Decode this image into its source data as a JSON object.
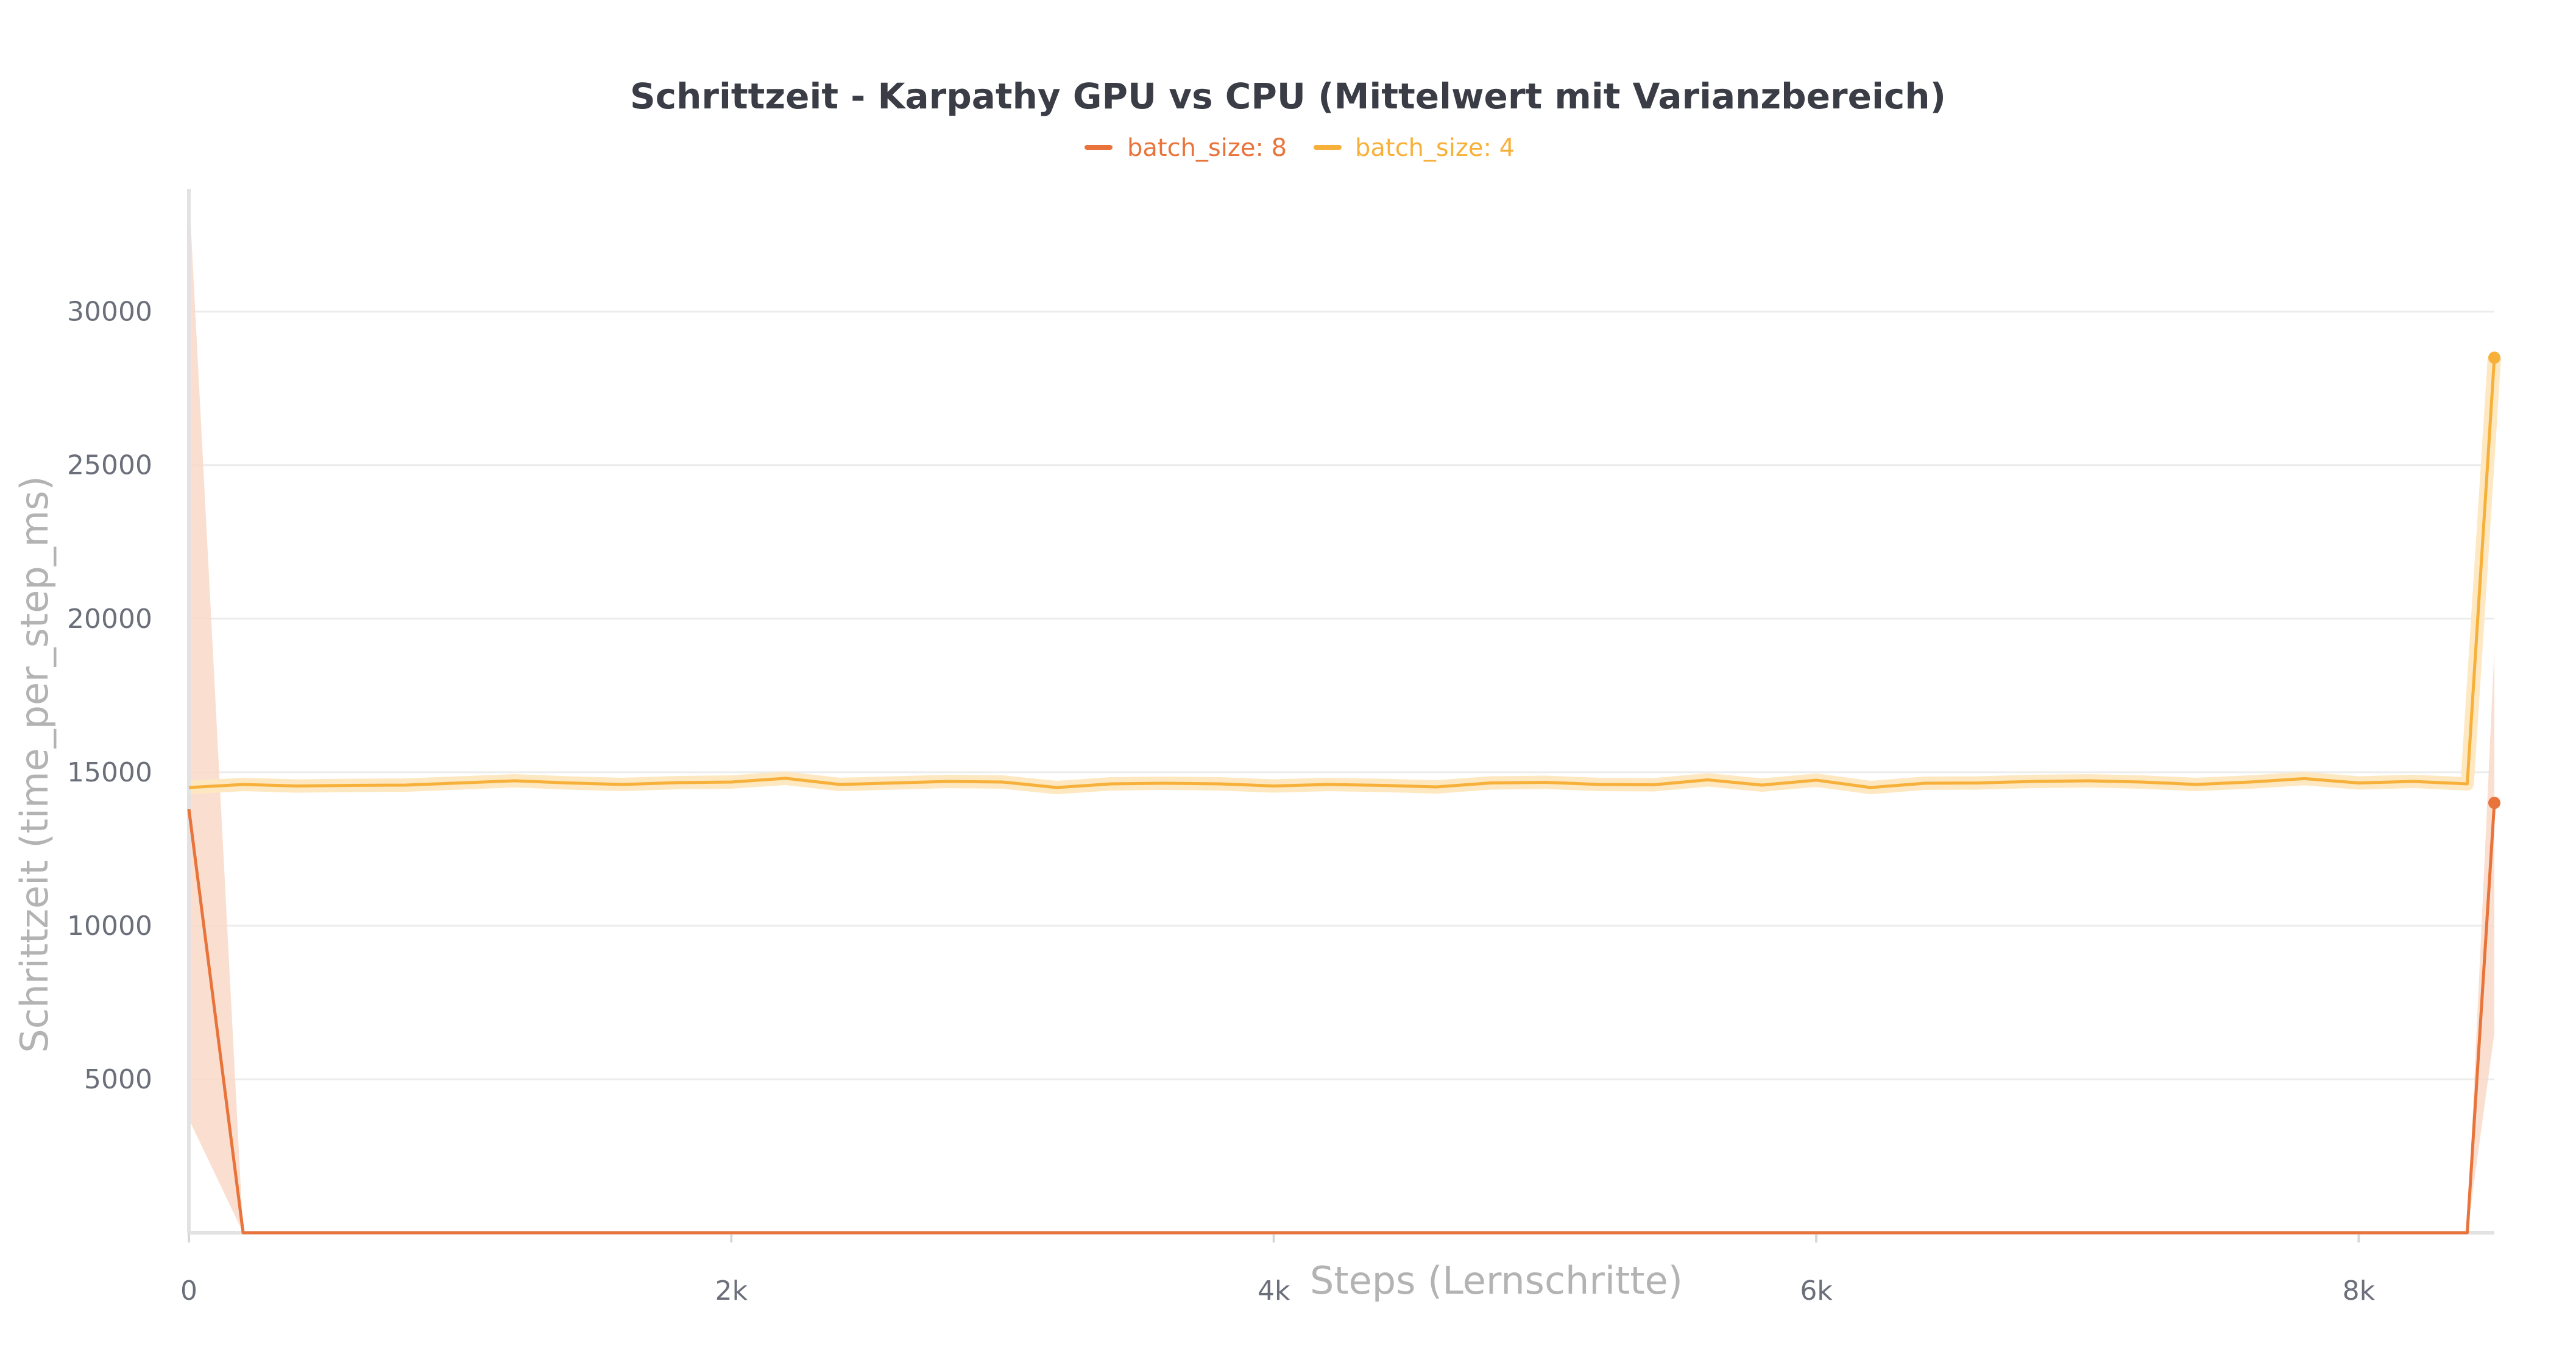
{
  "chart_data": {
    "type": "line",
    "title": "Schrittzeit - Karpathy GPU vs CPU (Mittelwert mit Varianzbereich)",
    "xlabel": "Steps (Lernschritte)",
    "ylabel": "Schrittzeit (time_per_step_ms)",
    "xlim": [
      0,
      8500
    ],
    "ylim": [
      0,
      34000
    ],
    "x_ticks": [
      {
        "value": 0,
        "label": "0"
      },
      {
        "value": 2000,
        "label": "2k"
      },
      {
        "value": 4000,
        "label": "4k"
      },
      {
        "value": 6000,
        "label": "6k"
      },
      {
        "value": 8000,
        "label": "8k"
      }
    ],
    "y_ticks": [
      {
        "value": 5000,
        "label": "5000"
      },
      {
        "value": 10000,
        "label": "10000"
      },
      {
        "value": 15000,
        "label": "15000"
      },
      {
        "value": 20000,
        "label": "20000"
      },
      {
        "value": 25000,
        "label": "25000"
      },
      {
        "value": 30000,
        "label": "30000"
      }
    ],
    "grid": true,
    "legend_position": "top-center",
    "series": [
      {
        "name": "batch_size: 8",
        "color": "#e8743b",
        "band_color": "#f9d9c8",
        "x": [
          0,
          200,
          8400,
          8500
        ],
        "y": [
          13800,
          0,
          0,
          14000
        ],
        "y_lower": [
          3700,
          0,
          0,
          6500
        ],
        "y_upper": [
          34000,
          0,
          0,
          19000
        ],
        "end_marker": true
      },
      {
        "name": "batch_size: 4",
        "color": "#f7b13b",
        "band_color": "#fde8c2",
        "x": [
          0,
          200,
          400,
          600,
          800,
          1000,
          1200,
          1400,
          1600,
          1800,
          2000,
          2200,
          2400,
          2600,
          2800,
          3000,
          3200,
          3400,
          3600,
          3800,
          4000,
          4200,
          4400,
          4600,
          4800,
          5000,
          5200,
          5400,
          5600,
          5800,
          6000,
          6200,
          6400,
          6600,
          6800,
          7000,
          7200,
          7400,
          7600,
          7800,
          8000,
          8200,
          8400,
          8500
        ],
        "y": [
          14500,
          14600,
          14550,
          14570,
          14580,
          14650,
          14720,
          14650,
          14600,
          14660,
          14680,
          14800,
          14600,
          14650,
          14700,
          14680,
          14500,
          14620,
          14640,
          14620,
          14550,
          14600,
          14570,
          14520,
          14650,
          14670,
          14600,
          14590,
          14750,
          14580,
          14740,
          14500,
          14640,
          14650,
          14700,
          14720,
          14680,
          14600,
          14680,
          14790,
          14650,
          14700,
          14620,
          28500
        ],
        "end_marker": true
      }
    ]
  }
}
